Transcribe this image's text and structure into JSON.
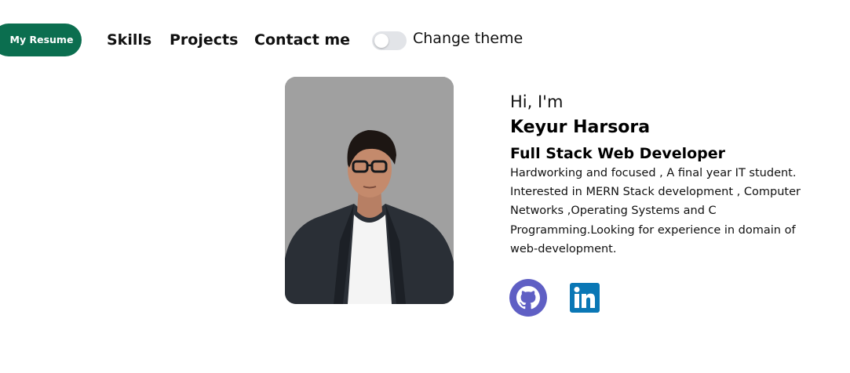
{
  "nav": {
    "resume_label": "My Resume",
    "links": [
      "Skills",
      "Projects",
      "Contact me"
    ],
    "theme_toggle_label": "Change theme",
    "theme_toggle_on": false
  },
  "hero": {
    "greeting": "Hi, I'm",
    "name": "Keyur Harsora",
    "role": "Full Stack Web Developer",
    "bio": "Hardworking and focused , A final year IT student. Interested in MERN Stack development , Computer Networks ,Operating Systems and C Programming.Looking for experience in domain of web-development.",
    "photo_icon": "profile-photo",
    "socials": [
      {
        "icon": "github-icon",
        "color": "#5f5fc4"
      },
      {
        "icon": "linkedin-icon",
        "color": "#0a77b5"
      }
    ]
  },
  "colors": {
    "accent": "#0b6e4f",
    "toggle_track": "#e2e4e8",
    "photo_bg": "#a0a0a0"
  }
}
